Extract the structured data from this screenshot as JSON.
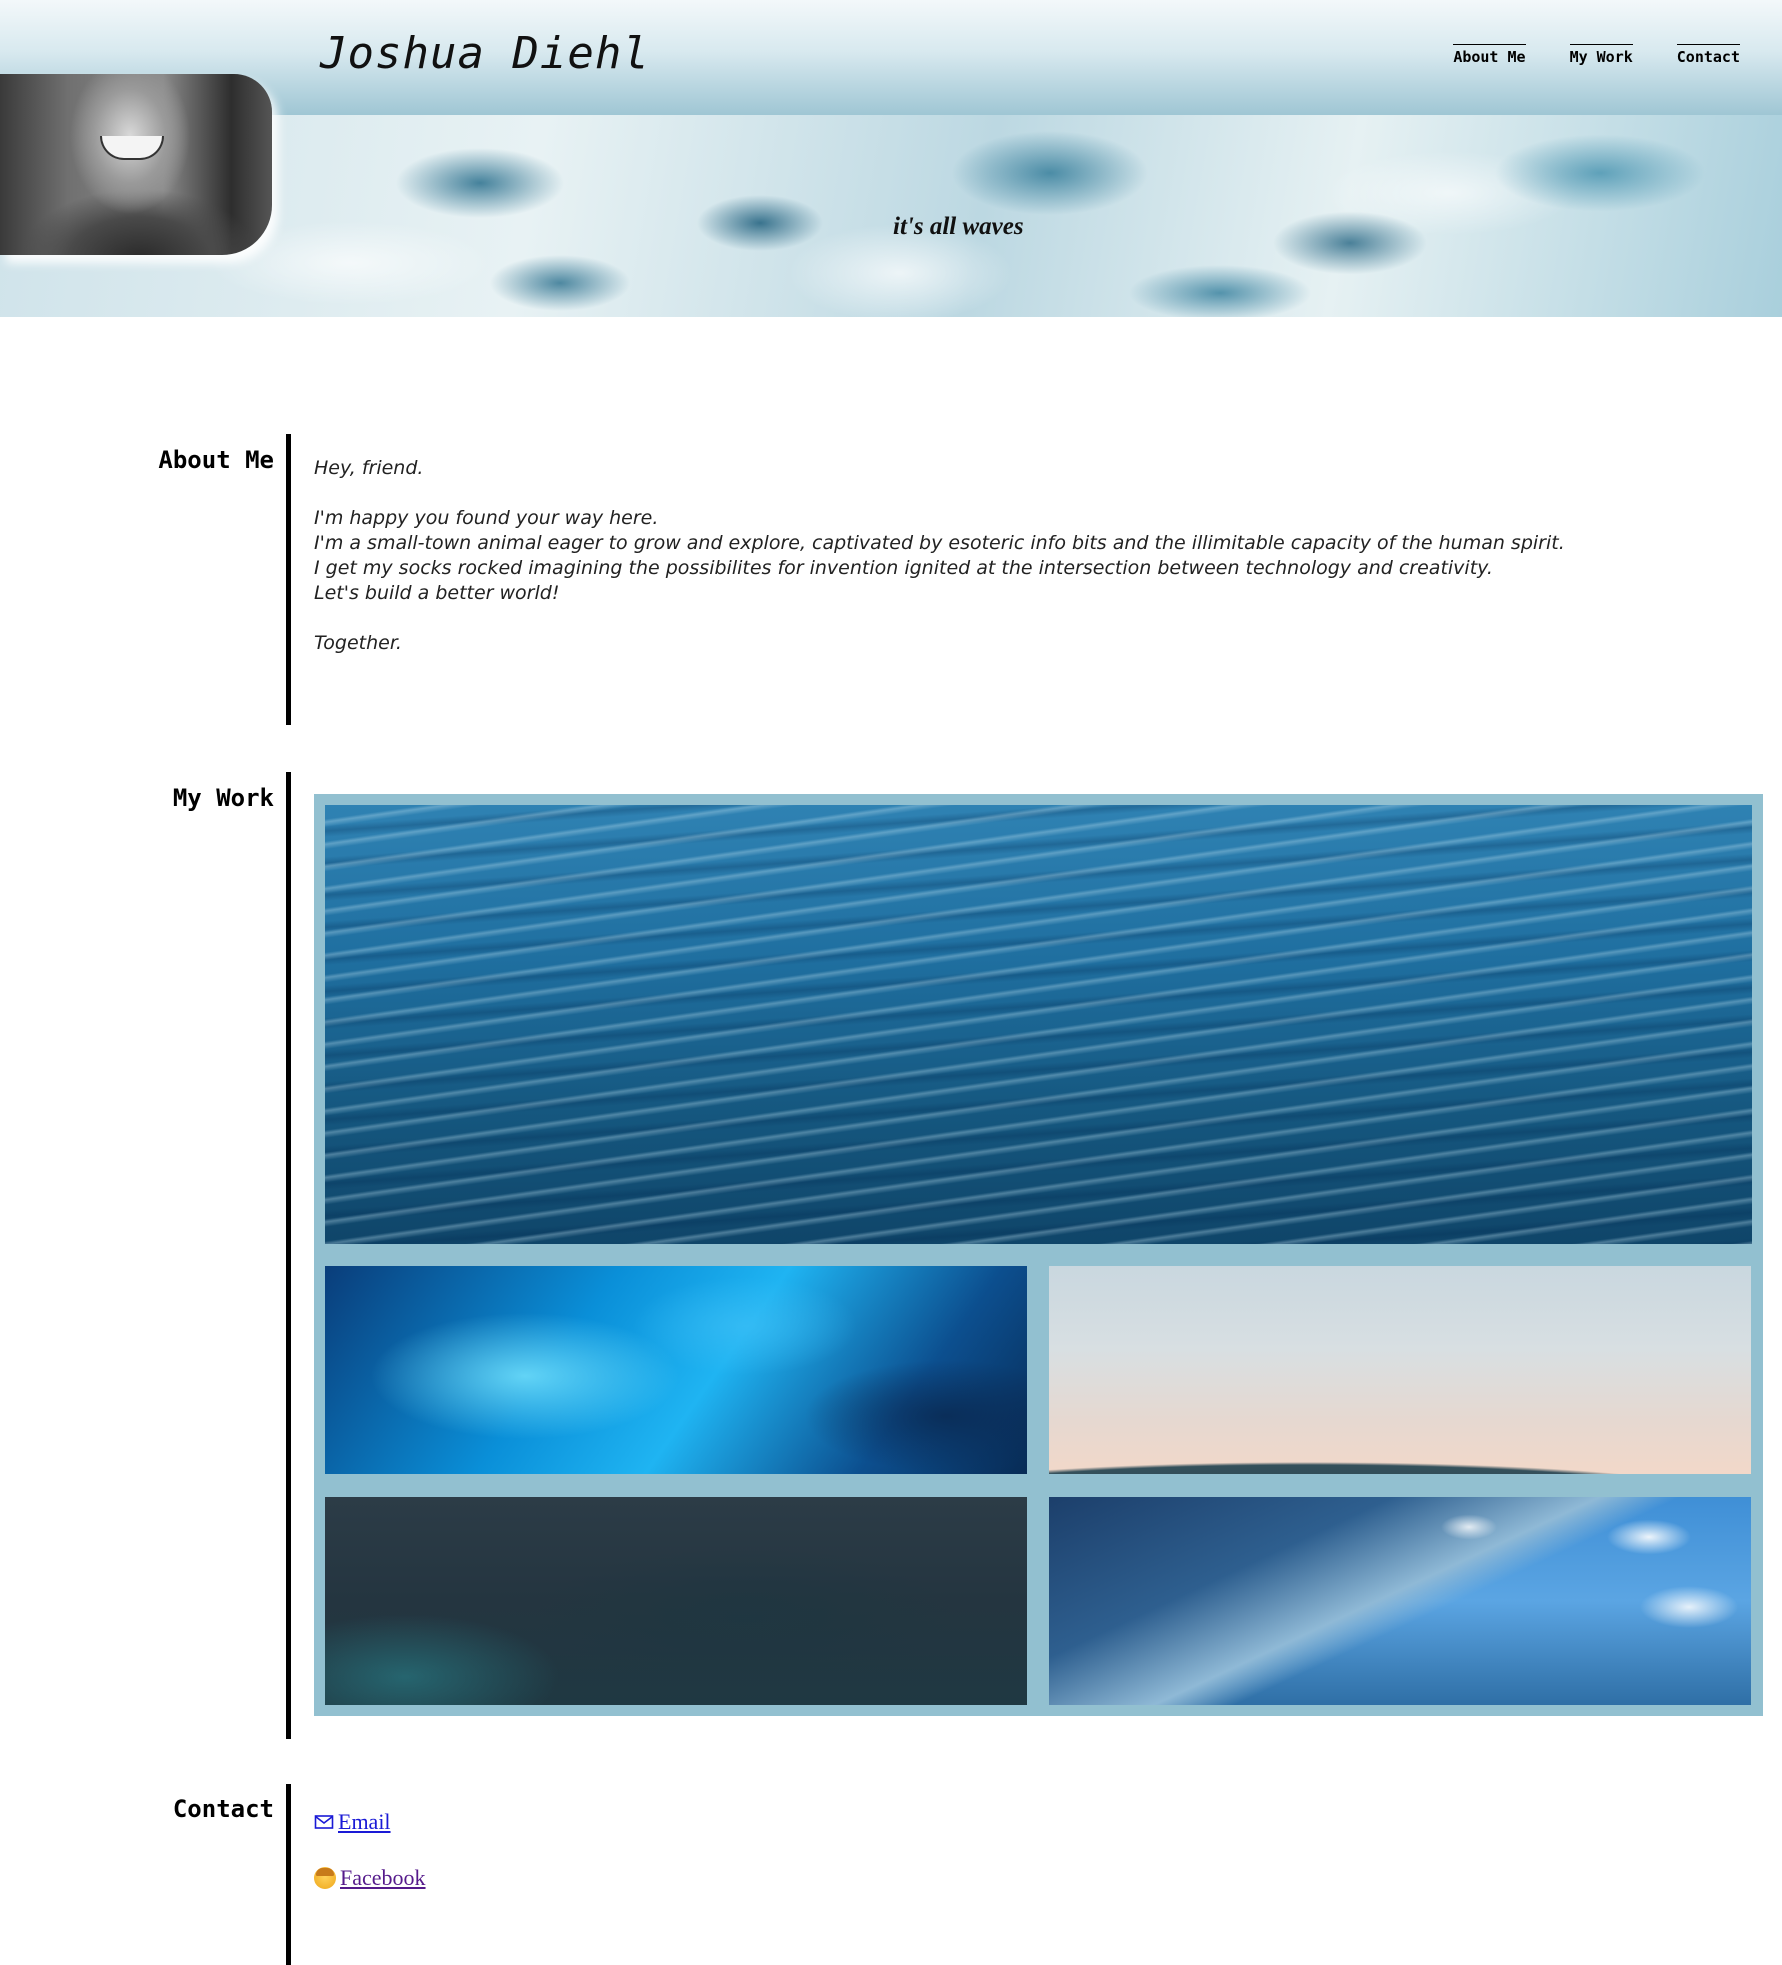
{
  "header": {
    "title": "Joshua Diehl",
    "tagline": "it's all waves",
    "nav": [
      "About Me",
      "My Work",
      "Contact"
    ]
  },
  "about": {
    "heading": "About Me",
    "lines": [
      "Hey, friend.",
      "",
      "I'm happy you found your way here.",
      "I'm a small-town animal eager to grow and explore, captivated by esoteric info bits and the illimitable capacity of the human spirit.",
      "I get my socks rocked imagining the possibilites for invention ignited at the intersection between technology and creativity.",
      "Let's build a better world!",
      "",
      "Together."
    ]
  },
  "work": {
    "heading": "My Work"
  },
  "contact": {
    "heading": "Contact",
    "email_label": "Email",
    "facebook_label": "Facebook"
  },
  "colors": {
    "accent": "#92c0d0",
    "link": "#1a1ad6",
    "visited_link": "#551a8b"
  }
}
